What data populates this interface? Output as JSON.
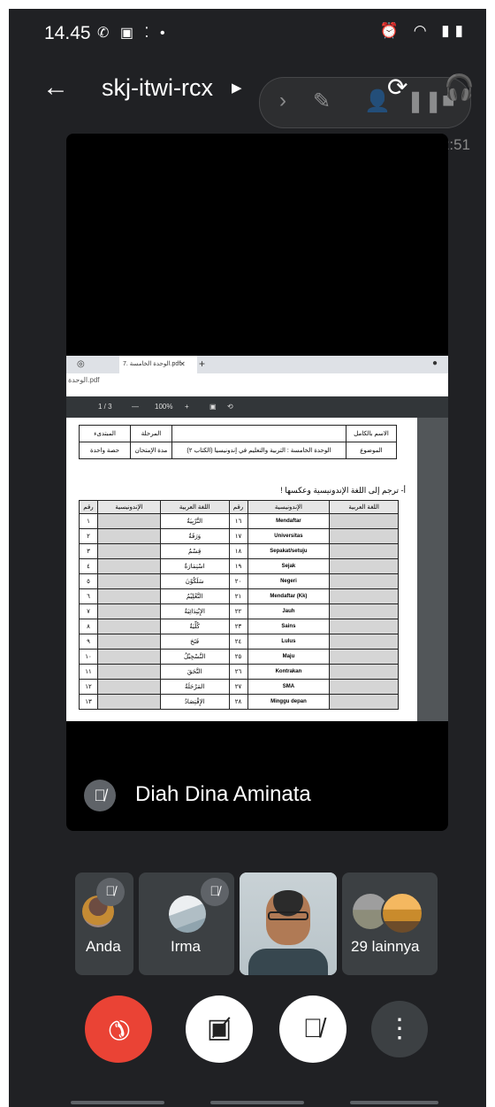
{
  "status_bar": {
    "time": "14.45",
    "left_icons": "✆ ▣ ⁚ •",
    "right_icons": "⏰ ◠ ▮▮"
  },
  "header": {
    "meeting_code": "skj-itwi-rcx",
    "timer": "22:51"
  },
  "browser": {
    "tab_title": "7. الوحدة الخامسة.pdf",
    "address": "الوحدة.pdf",
    "page_indicator": "1 / 3",
    "zoom": "100%"
  },
  "document": {
    "meta_rows": [
      {
        "label": "الاسم بالكامل",
        "value": "",
        "label2": "المرحلة",
        "value2": "المبتدىء"
      },
      {
        "label": "الموضوع",
        "value": "الوحدة الخامسة : التربية والتعليم في إندونيسيا (الكتاب ٢)",
        "label2": "مدة الإمتحان",
        "value2": "حصة واحدة"
      }
    ],
    "instruction": "أ-  ترجم إلى اللغة الإندونيسية وعكسها !",
    "columns": [
      "رقم",
      "الإندونيسية",
      "اللغة العربية",
      "رقم",
      "الإندونيسية",
      "اللغة العربية"
    ],
    "rows": [
      {
        "n1": "١",
        "ar1": "التَّرْبِيَةُ",
        "n2": "١٦",
        "id2": "Mendaftar"
      },
      {
        "n1": "٢",
        "ar1": "وَرَقَةٌ",
        "n2": "١٧",
        "id2": "Universitas"
      },
      {
        "n1": "٣",
        "ar1": "قِسْمٌ",
        "n2": "١٨",
        "id2": "Sepakat/setuju"
      },
      {
        "n1": "٤",
        "ar1": "اسْتِمَارَةٌ",
        "n2": "١٩",
        "id2": "Sejak"
      },
      {
        "n1": "٥",
        "ar1": "سَلَكُوْنَ",
        "n2": "٢٠",
        "id2": "Negeri"
      },
      {
        "n1": "٦",
        "ar1": "التَّعْلِيْمُ",
        "n2": "٢١",
        "id2": "Mendaftar (Kk)"
      },
      {
        "n1": "٧",
        "ar1": "الإِبْتِدَائِيَةُ",
        "n2": "٢٢",
        "id2": "Jauh"
      },
      {
        "n1": "٨",
        "ar1": "كُلِّيَةٌ",
        "n2": "٢٣",
        "id2": "Sains"
      },
      {
        "n1": "٩",
        "ar1": "فَتَحَ",
        "n2": "٢٤",
        "id2": "Lulus"
      },
      {
        "n1": "١٠",
        "ar1": "التَّسْجِيْلُ",
        "n2": "٢٥",
        "id2": "Maju"
      },
      {
        "n1": "١١",
        "ar1": "التَّحَقَ",
        "n2": "٢٦",
        "id2": "Kontrakan"
      },
      {
        "n1": "١٢",
        "ar1": "المَرْحَلَةُ",
        "n2": "٢٧",
        "id2": "SMA"
      },
      {
        "n1": "١٣",
        "ar1": "الإِقْتِصَادُ",
        "n2": "٢٨",
        "id2": "Minggu depan"
      }
    ]
  },
  "presenter": {
    "name": "Diah Dina Aminata"
  },
  "participants": {
    "self_label": "Anda",
    "p2_label": "Irma",
    "others_label": "29 lainnya"
  },
  "colors": {
    "background": "#202124",
    "tile": "#3c4043",
    "end_call": "#ea4335"
  }
}
